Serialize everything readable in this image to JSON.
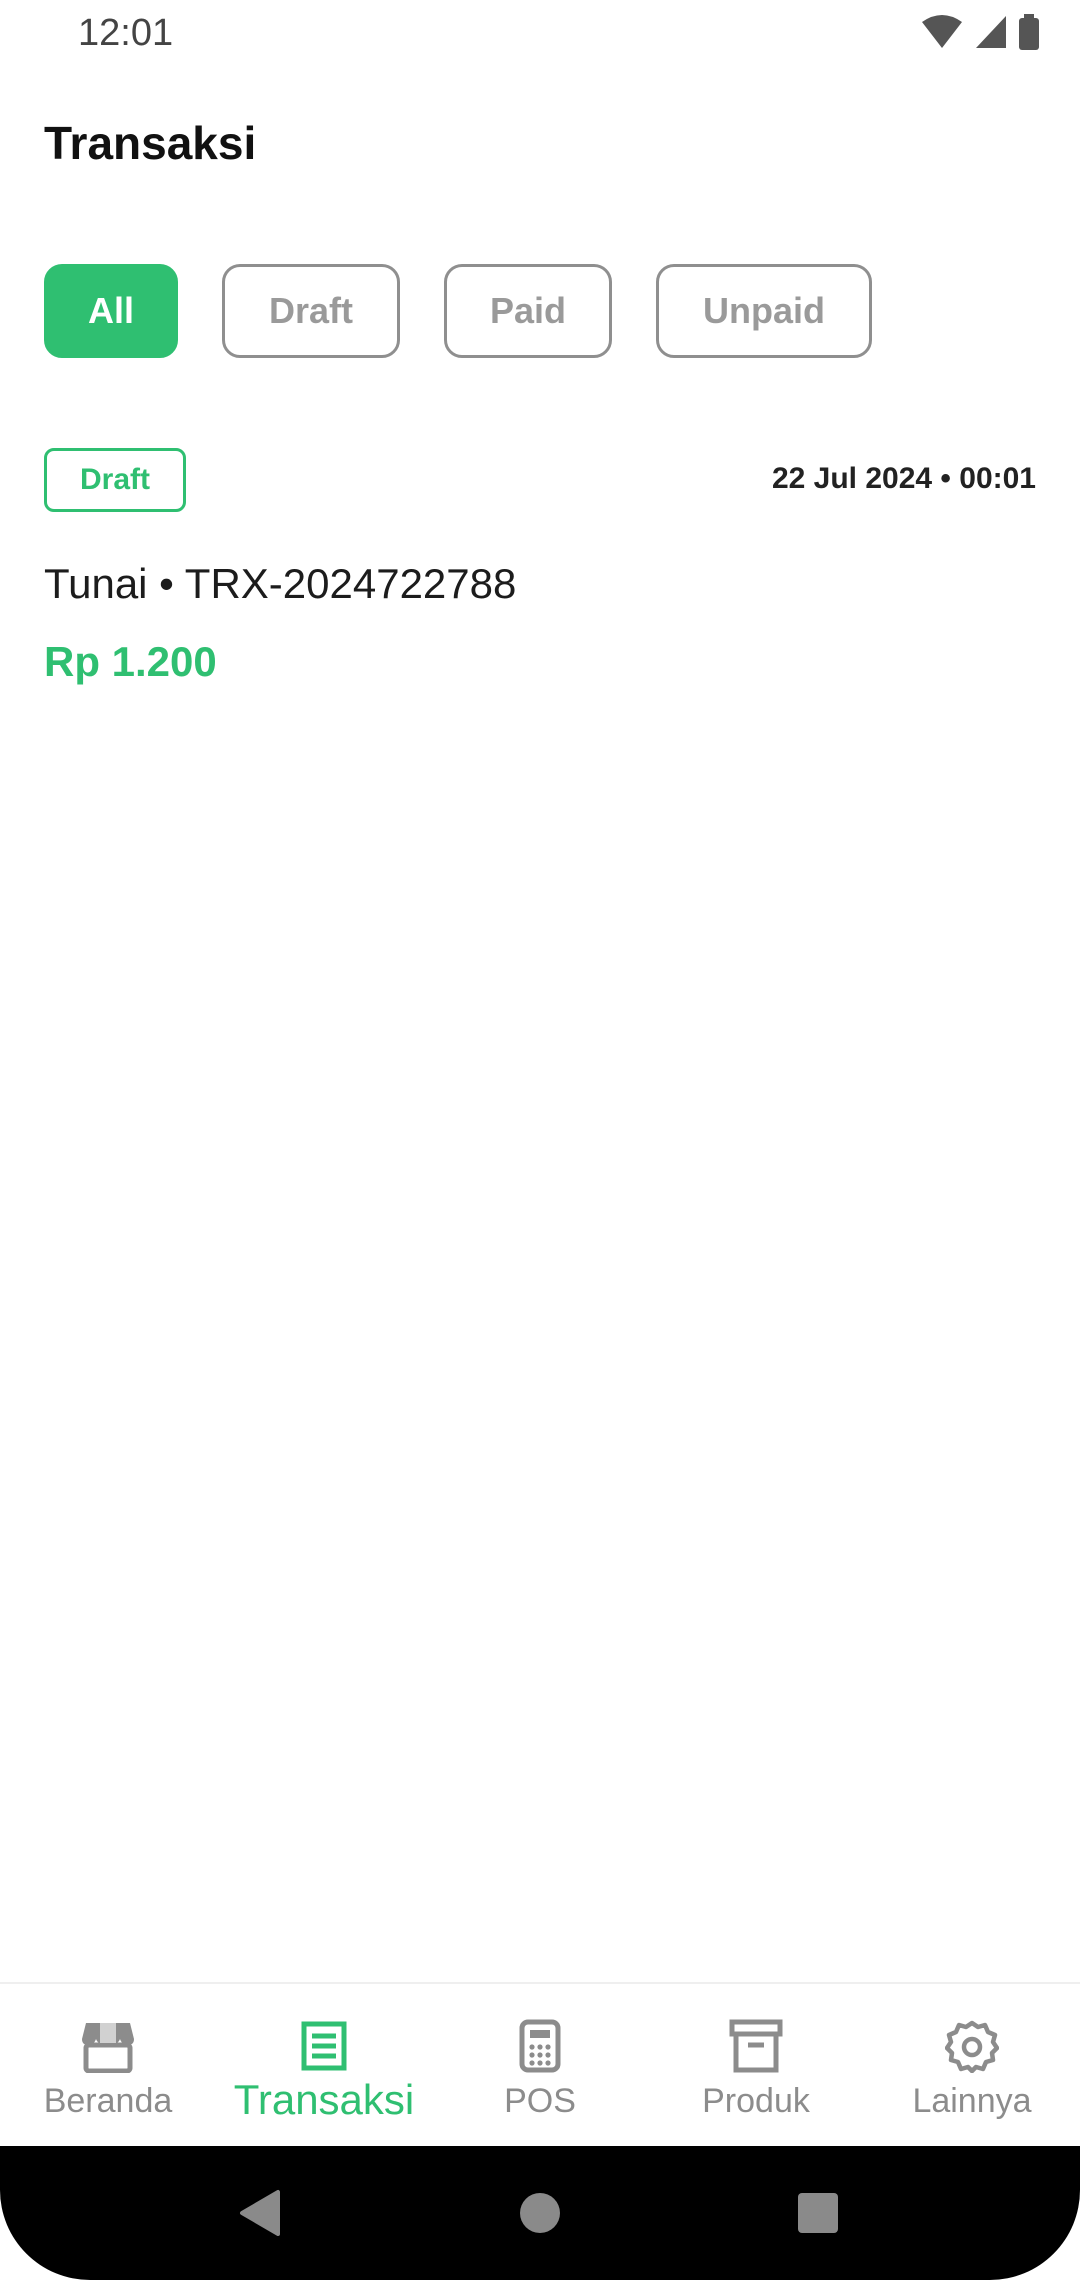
{
  "status_bar": {
    "time": "12:01"
  },
  "header": {
    "title": "Transaksi"
  },
  "filters": [
    {
      "label": "All",
      "active": true
    },
    {
      "label": "Draft",
      "active": false
    },
    {
      "label": "Paid",
      "active": false
    },
    {
      "label": "Unpaid",
      "active": false
    }
  ],
  "transactions": [
    {
      "status": "Draft",
      "date": "22 Jul 2024 • 00:01",
      "title": "Tunai • TRX-2024722788",
      "amount": "Rp 1.200"
    }
  ],
  "bottom_nav": [
    {
      "label": "Beranda",
      "icon": "store-icon",
      "active": false
    },
    {
      "label": "Transaksi",
      "icon": "receipt-icon",
      "active": true
    },
    {
      "label": "POS",
      "icon": "calculator-icon",
      "active": false
    },
    {
      "label": "Produk",
      "icon": "archive-box-icon",
      "active": false
    },
    {
      "label": "Lainnya",
      "icon": "gear-icon",
      "active": false
    }
  ],
  "colors": {
    "accent": "#2fbf71",
    "muted": "#8c8c8c"
  }
}
